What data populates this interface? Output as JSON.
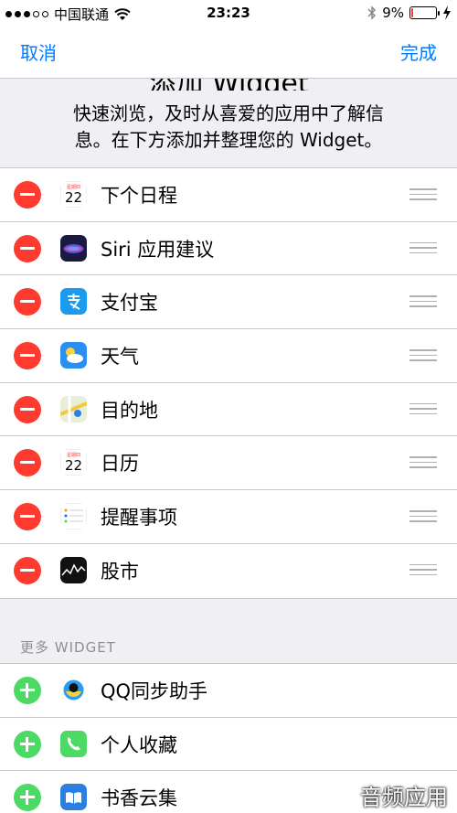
{
  "status": {
    "carrier": "中国联通",
    "time": "23:23",
    "battery_pct": "9%",
    "battery_level": 0.09,
    "battery_color": "#ff3b30",
    "signal_bars": 3
  },
  "nav": {
    "cancel": "取消",
    "done": "完成",
    "title": "添加 Widget"
  },
  "description": {
    "line1": "快速浏览，及时从喜爱的应用中了解信",
    "line2": "息。在下方添加并整理您的 Widget。"
  },
  "active_widgets": [
    {
      "label": "下个日程",
      "icon": "calendar-icon"
    },
    {
      "label": "Siri 应用建议",
      "icon": "siri-icon"
    },
    {
      "label": "支付宝",
      "icon": "alipay-icon"
    },
    {
      "label": "天气",
      "icon": "weather-icon"
    },
    {
      "label": "目的地",
      "icon": "maps-icon"
    },
    {
      "label": "日历",
      "icon": "calendar-icon"
    },
    {
      "label": "提醒事项",
      "icon": "reminders-icon"
    },
    {
      "label": "股市",
      "icon": "stocks-icon"
    }
  ],
  "more_section": {
    "header": "更多 WIDGET",
    "items": [
      {
        "label": "QQ同步助手",
        "icon": "qq-sync-icon"
      },
      {
        "label": "个人收藏",
        "icon": "phone-icon"
      },
      {
        "label": "书香云集",
        "icon": "book-icon"
      }
    ]
  },
  "calendar_icon": {
    "weekday": "星期四",
    "day": "22"
  },
  "watermark": "音频应用",
  "colors": {
    "accent": "#007aff",
    "remove": "#ff3b30",
    "add": "#4cd964",
    "background": "#efeff4"
  }
}
